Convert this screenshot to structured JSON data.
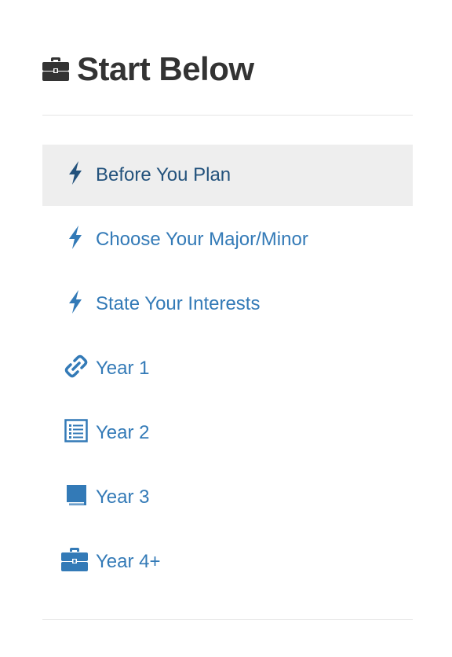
{
  "header": {
    "title": "Start Below",
    "icon": "briefcase-icon"
  },
  "colors": {
    "link": "#337ab7",
    "link_active": "#23527c",
    "active_bg": "#eeeeee",
    "heading": "#333333",
    "divider": "#e5e5e5"
  },
  "nav": {
    "items": [
      {
        "label": "Before You Plan",
        "icon": "bolt-icon",
        "active": true
      },
      {
        "label": "Choose Your Major/Minor",
        "icon": "bolt-icon",
        "active": false
      },
      {
        "label": "State Your Interests",
        "icon": "bolt-icon",
        "active": false
      },
      {
        "label": "Year 1",
        "icon": "link-icon",
        "active": false
      },
      {
        "label": "Year 2",
        "icon": "list-alt-icon",
        "active": false
      },
      {
        "label": "Year 3",
        "icon": "book-icon",
        "active": false
      },
      {
        "label": "Year 4+",
        "icon": "briefcase-icon",
        "active": false
      }
    ]
  }
}
